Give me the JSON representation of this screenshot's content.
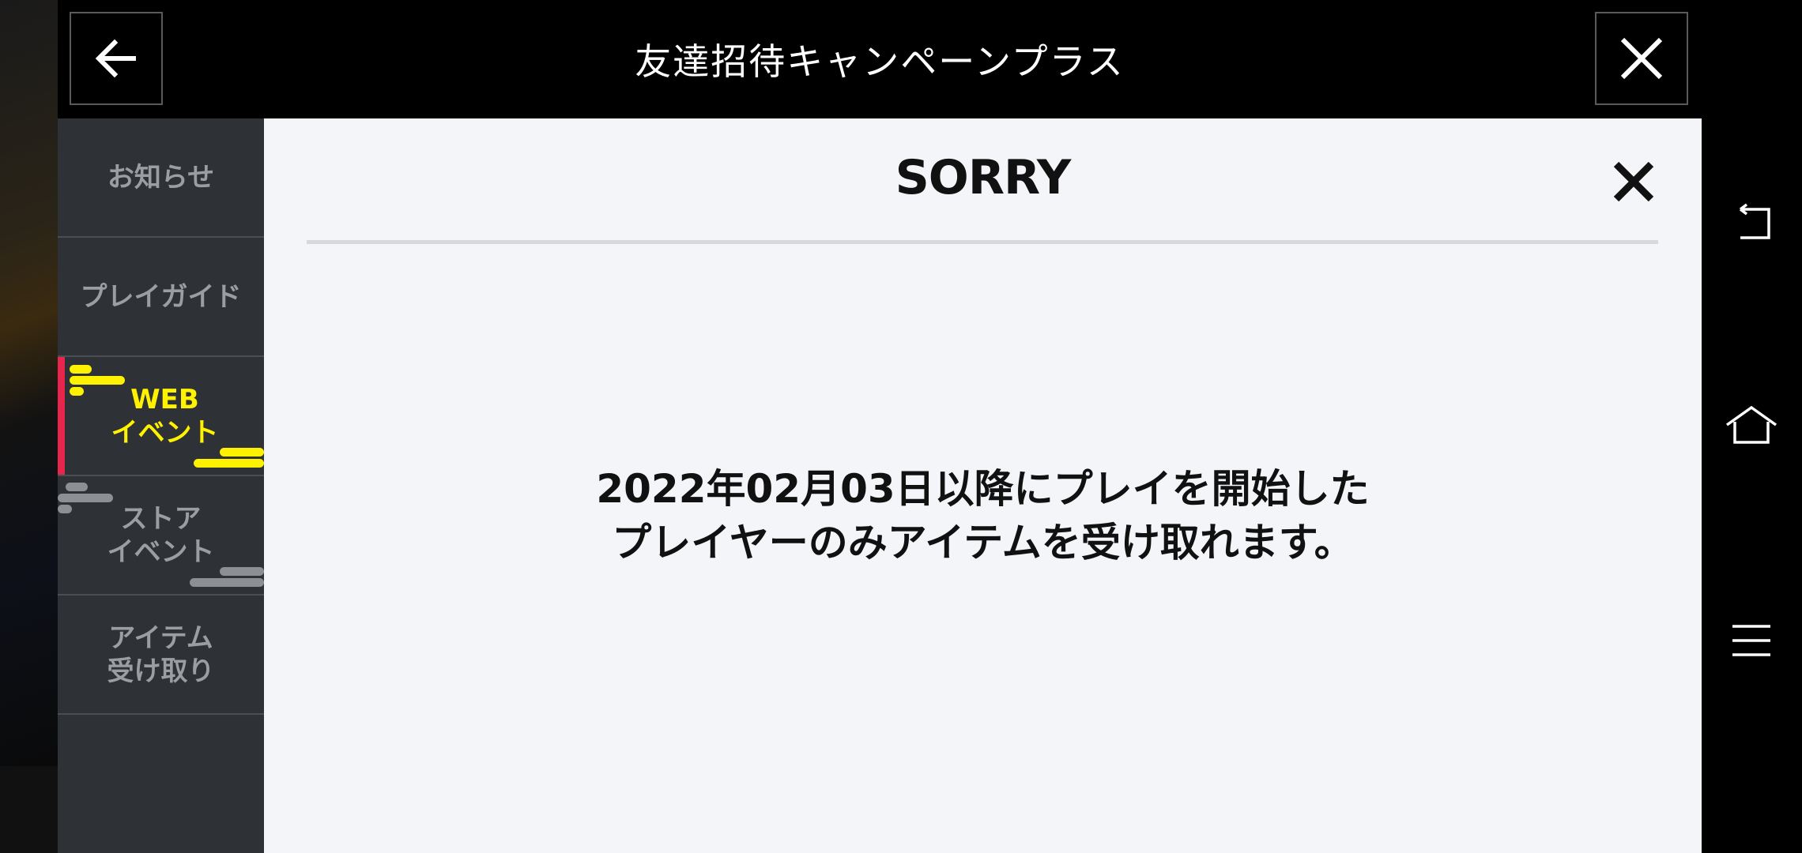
{
  "header": {
    "title": "友達招待キャンペーンプラス",
    "back_icon": "arrow-left-icon",
    "close_icon": "close-icon"
  },
  "sidebar": {
    "items": [
      {
        "label": "お知らせ",
        "active": false
      },
      {
        "label": "プレイガイド",
        "active": false
      },
      {
        "label": "WEB\nイベント",
        "active": true
      },
      {
        "label": "ストア\nイベント",
        "active": false
      },
      {
        "label": "アイテム\n受け取り",
        "active": false
      }
    ],
    "accent_color": "#e8254c",
    "active_text_color": "#fff200"
  },
  "dialog": {
    "title": "SORRY",
    "message": "2022年02月03日以降にプレイを開始した\nプレイヤーのみアイテムを受け取れます。",
    "close_icon": "close-icon"
  },
  "navbar": {
    "icons": [
      "back-icon",
      "home-icon",
      "menu-icon"
    ]
  }
}
